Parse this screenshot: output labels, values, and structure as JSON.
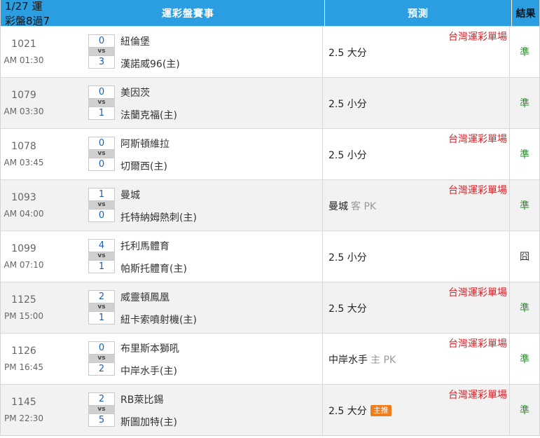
{
  "header": {
    "date_title": "1/27 運彩盤8過7",
    "match_col": "運彩盤賽事",
    "pred_col": "預測",
    "result_col": "結果"
  },
  "colors": {
    "header_bg": "#2a9ee0",
    "tag_red": "#d4252b",
    "win_green": "#2b8c2b",
    "badge_orange": "#ef7d1e"
  },
  "rows": [
    {
      "code": "1021",
      "time": "AM 01:30",
      "away_score": "0",
      "vs": "vs",
      "home_score": "3",
      "away_team": "紐倫堡",
      "home_team": "漢諾威96(主)",
      "tag": "台灣運彩單場",
      "pick": "2.5 大分",
      "pick_sub": "",
      "badge": "",
      "result": "準"
    },
    {
      "code": "1079",
      "time": "AM 03:30",
      "away_score": "0",
      "vs": "vs",
      "home_score": "1",
      "away_team": "美因茨",
      "home_team": "法蘭克福(主)",
      "tag": "",
      "pick": "2.5 小分",
      "pick_sub": "",
      "badge": "",
      "result": "準"
    },
    {
      "code": "1078",
      "time": "AM 03:45",
      "away_score": "0",
      "vs": "vs",
      "home_score": "0",
      "away_team": "阿斯頓維拉",
      "home_team": "切爾西(主)",
      "tag": "台灣運彩單場",
      "pick": "2.5 小分",
      "pick_sub": "",
      "badge": "",
      "result": "準"
    },
    {
      "code": "1093",
      "time": "AM 04:00",
      "away_score": "1",
      "vs": "vs",
      "home_score": "0",
      "away_team": "曼城",
      "home_team": "托特納姆熱刺(主)",
      "tag": "台灣運彩單場",
      "pick": "曼城",
      "pick_sub": "客 PK",
      "badge": "",
      "result": "準"
    },
    {
      "code": "1099",
      "time": "AM 07:10",
      "away_score": "4",
      "vs": "vs",
      "home_score": "1",
      "away_team": "托利馬體育",
      "home_team": "帕斯托體育(主)",
      "tag": "",
      "pick": "2.5 小分",
      "pick_sub": "",
      "badge": "",
      "result": "囧"
    },
    {
      "code": "1125",
      "time": "PM 15:00",
      "away_score": "2",
      "vs": "vs",
      "home_score": "1",
      "away_team": "威靈頓鳳凰",
      "home_team": "紐卡索噴射機(主)",
      "tag": "台灣運彩單場",
      "pick": "2.5 大分",
      "pick_sub": "",
      "badge": "",
      "result": "準"
    },
    {
      "code": "1126",
      "time": "PM 16:45",
      "away_score": "0",
      "vs": "vs",
      "home_score": "2",
      "away_team": "布里斯本獅吼",
      "home_team": "中岸水手(主)",
      "tag": "台灣運彩單場",
      "pick": "中岸水手",
      "pick_sub": "主 PK",
      "badge": "",
      "result": "準"
    },
    {
      "code": "1145",
      "time": "PM 22:30",
      "away_score": "2",
      "vs": "vs",
      "home_score": "5",
      "away_team": "RB萊比錫",
      "home_team": "斯圖加特(主)",
      "tag": "台灣運彩單場",
      "pick": "2.5 大分",
      "pick_sub": "",
      "badge": "主推",
      "result": "準"
    }
  ]
}
